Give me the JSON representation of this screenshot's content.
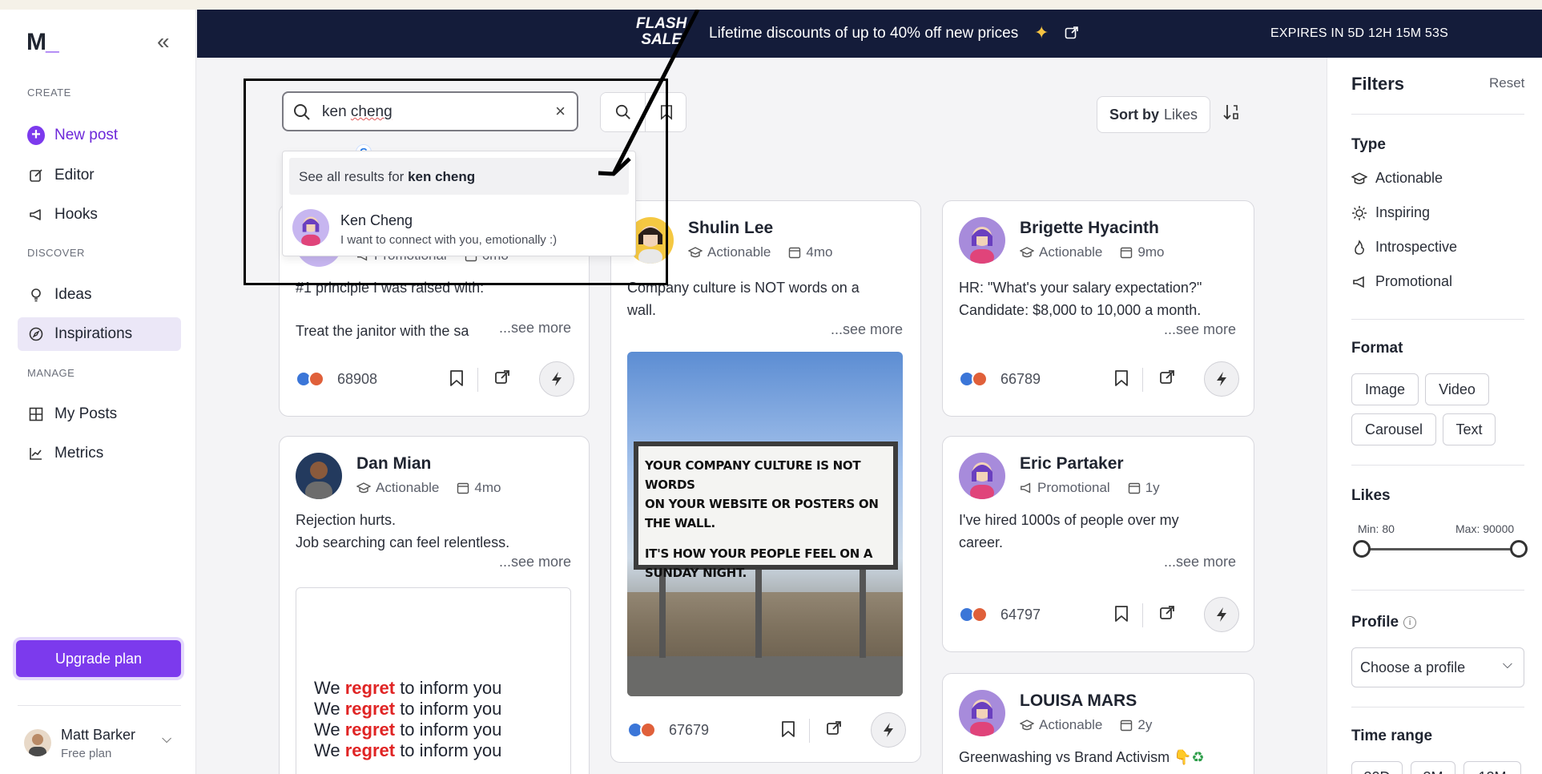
{
  "app": {
    "logo_text": "M",
    "logo_accent": "_"
  },
  "sidebar": {
    "sections": [
      {
        "label": "CREATE"
      },
      {
        "label": "DISCOVER"
      },
      {
        "label": "MANAGE"
      }
    ],
    "items": [
      {
        "label": "New post"
      },
      {
        "label": "Editor"
      },
      {
        "label": "Hooks"
      },
      {
        "label": "Ideas"
      },
      {
        "label": "Inspirations"
      },
      {
        "label": "My Posts"
      },
      {
        "label": "Metrics"
      }
    ],
    "upgrade_label": "Upgrade plan",
    "user": {
      "name": "Matt Barker",
      "plan": "Free plan"
    }
  },
  "banner": {
    "flash_line1": "FLASH",
    "flash_line2": "SALE",
    "message": "Lifetime discounts of up to 40% off new prices",
    "expires": "EXPIRES IN 5D 12H 15M 53S"
  },
  "search": {
    "value_part1": "ken ",
    "value_part2": "cheng",
    "dropdown_prefix": "See all results for ",
    "dropdown_query": "ken cheng",
    "result": {
      "name": "Ken Cheng",
      "subtitle": "I want to connect with you, emotionally :)"
    }
  },
  "sort": {
    "label": "Sort by",
    "value": "Likes"
  },
  "cards": [
    {
      "meta1": "Promotional",
      "meta2": "6mo",
      "text1": "#1 principle I was raised with:",
      "text2": "Treat the janitor with the sa",
      "more": "...see more",
      "likes": "68908"
    },
    {
      "name": "Shulin Lee",
      "meta1": "Actionable",
      "meta2": "4mo",
      "text1": "Company culture is NOT words on a",
      "text2": "wall.",
      "more": "...see more",
      "image_lines": [
        "YOUR COMPANY CULTURE IS NOT WORDS",
        "ON YOUR WEBSITE OR POSTERS ON THE WALL.",
        "IT'S HOW YOUR PEOPLE FEEL ON A",
        "SUNDAY NIGHT."
      ],
      "likes": "67679"
    },
    {
      "name": "Brigette Hyacinth",
      "meta1": "Actionable",
      "meta2": "9mo",
      "text1": "HR: \"What's your salary expectation?\"",
      "text2": "Candidate: $8,000 to 10,000 a month.",
      "more": "...see more",
      "likes": "66789"
    },
    {
      "name": "Dan Mian",
      "meta1": "Actionable",
      "meta2": "4mo",
      "text1": "Rejection hurts.",
      "text2": "Job searching can feel relentless.",
      "more": "...see more",
      "regret": {
        "before": "We ",
        "word": "regret",
        "after": " to inform you"
      }
    },
    {
      "name": "Eric Partaker",
      "meta1": "Promotional",
      "meta2": "1y",
      "text1": "I've hired 1000s of people over my",
      "text2": "career.",
      "more": "...see more",
      "likes": "64797"
    },
    {
      "name": "LOUISA MARS",
      "meta1": "Actionable",
      "meta2": "2y",
      "text1": "Greenwashing vs Brand Activism"
    }
  ],
  "filters": {
    "title": "Filters",
    "reset": "Reset",
    "type_label": "Type",
    "types": [
      "Actionable",
      "Inspiring",
      "Introspective",
      "Promotional"
    ],
    "format_label": "Format",
    "formats": [
      "Image",
      "Video",
      "Carousel",
      "Text"
    ],
    "likes_label": "Likes",
    "likes_min": "Min: 80",
    "likes_max": "Max: 90000",
    "profile_label": "Profile",
    "profile_placeholder": "Choose a profile",
    "time_label": "Time range",
    "times": [
      "30D",
      "3M",
      "12M"
    ]
  },
  "colors": {
    "accent": "#7c3aed",
    "banner": "#141c3a",
    "regret_red": "#e02424"
  }
}
